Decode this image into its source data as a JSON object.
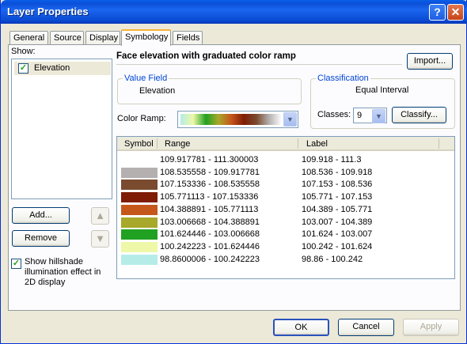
{
  "window": {
    "title": "Layer Properties"
  },
  "titlebar": {
    "help": "?",
    "close": "✕"
  },
  "tabs": [
    {
      "label": "General"
    },
    {
      "label": "Source"
    },
    {
      "label": "Display"
    },
    {
      "label": "Symbology"
    },
    {
      "label": "Fields"
    }
  ],
  "show": {
    "label": "Show:",
    "items": [
      {
        "label": "Elevation",
        "checked": true
      }
    ],
    "add_label": "Add...",
    "remove_label": "Remove",
    "up_icon": "▲",
    "down_icon": "▼"
  },
  "hillshade": {
    "label": "Show hillshade illumination effect in 2D display",
    "checked": true
  },
  "description": "Face elevation with graduated color ramp",
  "import_label": "Import...",
  "value_field": {
    "title": "Value Field",
    "value": "Elevation"
  },
  "classification": {
    "title": "Classification",
    "method": "Equal Interval",
    "classes_label": "Classes:",
    "classes_value": "9",
    "classify_label": "Classify..."
  },
  "color_ramp": {
    "label": "Color Ramp:",
    "colors": [
      "#b6ece8",
      "#eef8a8",
      "#21a121",
      "#a8a82a",
      "#c6571b",
      "#7e1c06",
      "#7a4b2f",
      "#b4b0b0",
      "#ffffff"
    ]
  },
  "table": {
    "headers": [
      "Symbol",
      "Range",
      "Label"
    ],
    "rows": [
      {
        "color": "#ffffff",
        "range": "109.917781 - 111.300003",
        "label": "109.918 - 111.3"
      },
      {
        "color": "#b4b0b0",
        "range": "108.535558 - 109.917781",
        "label": "108.536 - 109.918"
      },
      {
        "color": "#7a4b2f",
        "range": "107.153336 - 108.535558",
        "label": "107.153 - 108.536"
      },
      {
        "color": "#7e1c06",
        "range": "105.771113 - 107.153336",
        "label": "105.771 - 107.153"
      },
      {
        "color": "#c6571b",
        "range": "104.388891 - 105.771113",
        "label": "104.389 - 105.771"
      },
      {
        "color": "#a8a82a",
        "range": "103.006668 - 104.388891",
        "label": "103.007 - 104.389"
      },
      {
        "color": "#21a121",
        "range": "101.624446 - 103.006668",
        "label": "101.624 - 103.007"
      },
      {
        "color": "#eef8a8",
        "range": "100.242223 - 101.624446",
        "label": "100.242 - 101.624"
      },
      {
        "color": "#b6ece8",
        "range": "98.8600006 - 100.242223",
        "label": "98.86 - 100.242"
      }
    ]
  },
  "footer": {
    "ok": "OK",
    "cancel": "Cancel",
    "apply": "Apply"
  }
}
